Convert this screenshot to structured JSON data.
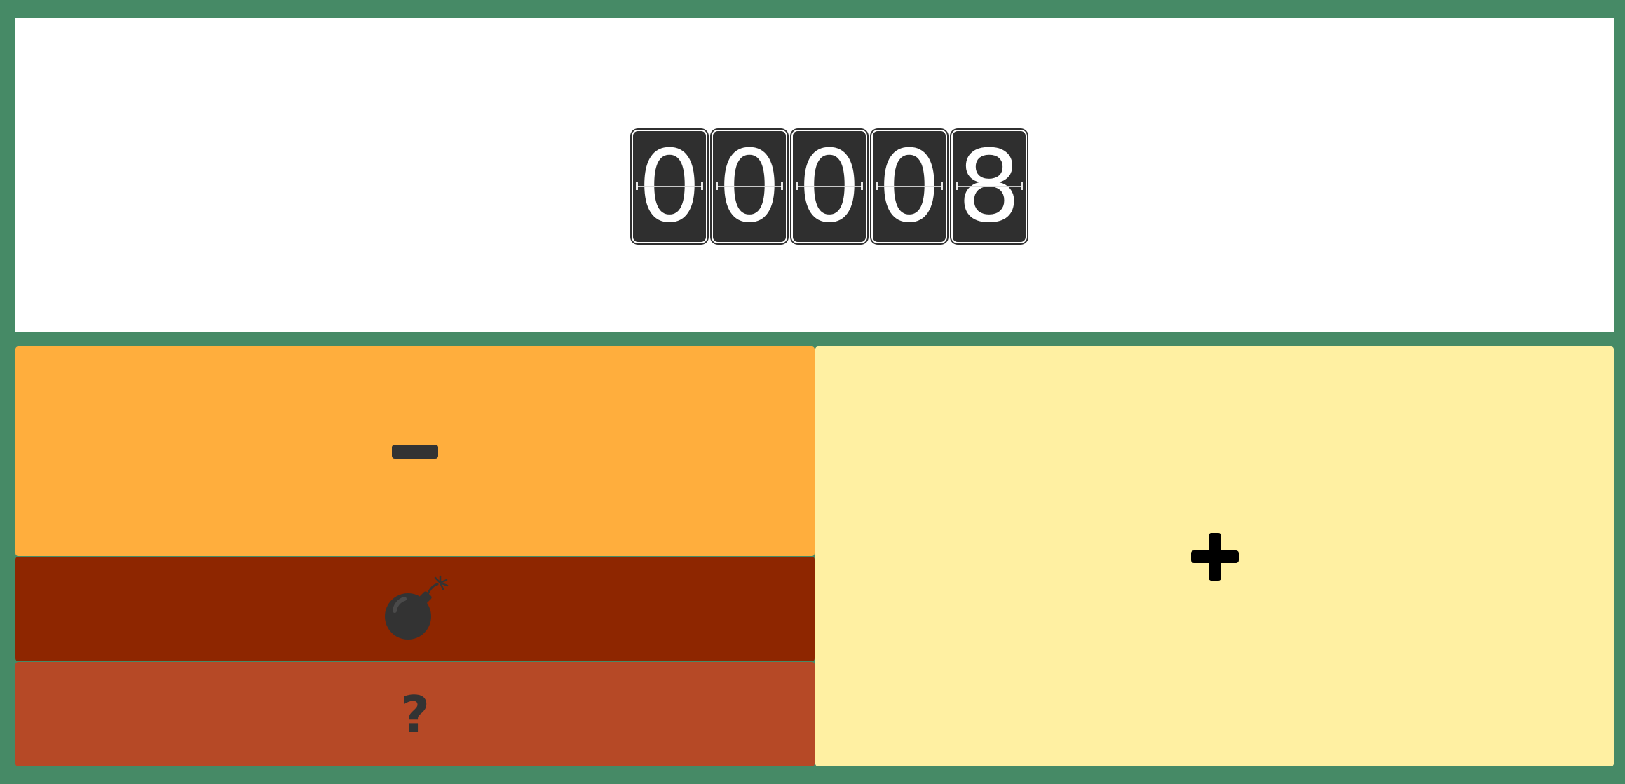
{
  "counter": {
    "digits": [
      "0",
      "0",
      "0",
      "0",
      "8"
    ]
  },
  "buttons": {
    "decrement": {
      "icon": "minus-icon",
      "color": "#ffae3d"
    },
    "reset": {
      "icon": "bomb-icon",
      "color": "#8e2600"
    },
    "help": {
      "icon": "question-mark-icon",
      "label": "?",
      "color": "#b64926"
    },
    "increment": {
      "icon": "plus-icon",
      "color": "#fff0a2"
    }
  },
  "colors": {
    "background": "#468a66",
    "display": "#ffffff",
    "digit_card": "#2f2f2f",
    "icon": "#333333"
  }
}
